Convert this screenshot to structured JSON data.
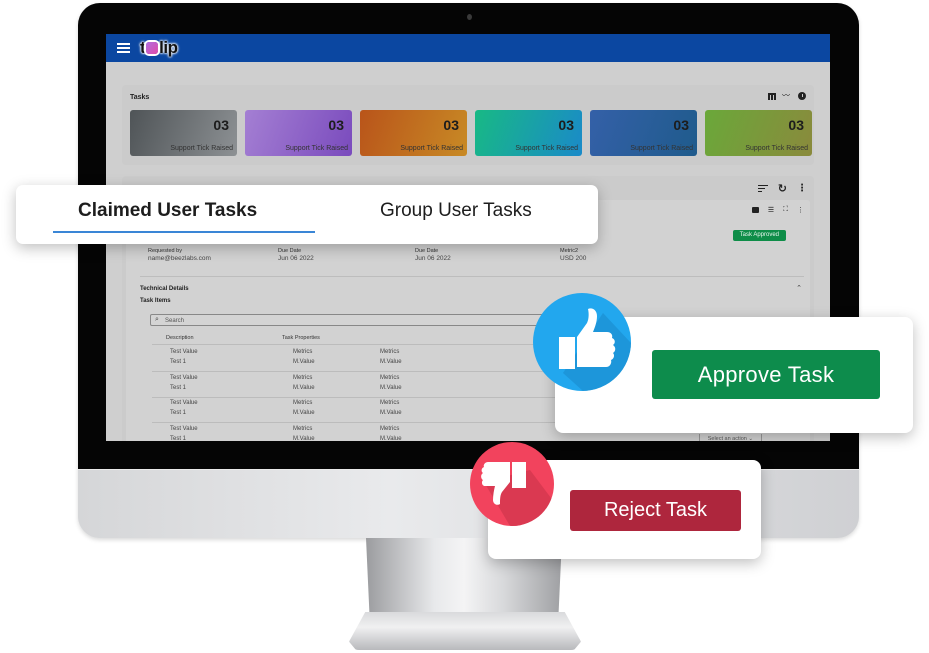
{
  "app": {
    "logo_text_left": "t",
    "logo_text_right": "lip"
  },
  "tasks": {
    "title": "Tasks",
    "view_icons": [
      "table-icon",
      "trend-icon",
      "clock-icon"
    ],
    "cards": [
      {
        "count": "03",
        "label": "Support Tick Raised",
        "color_from": "#4f5457",
        "color_to": "#8d9194"
      },
      {
        "count": "03",
        "label": "Support Tick Raised",
        "color_from": "#a47fd3",
        "color_to": "#7a4bbd"
      },
      {
        "count": "03",
        "label": "Support Tick Raised",
        "color_from": "#b9541a",
        "color_to": "#c88a25"
      },
      {
        "count": "03",
        "label": "Support Tick Raised",
        "color_from": "#18b984",
        "color_to": "#1a8ac9"
      },
      {
        "count": "03",
        "label": "Support Tick Raised",
        "color_from": "#3460a8",
        "color_to": "#1f5b8c"
      },
      {
        "count": "03",
        "label": "Support Tick Raised",
        "color_from": "#6aa83a",
        "color_to": "#8a8a3c"
      }
    ]
  },
  "tabs": {
    "items": [
      {
        "label": "Claimed User Tasks",
        "active": true
      },
      {
        "label": "Group User Tasks",
        "active": false
      }
    ],
    "accent": "#3a86d6"
  },
  "task_detail": {
    "status_badge": "Task Approved",
    "status_color": "#0e8d48",
    "meta": [
      {
        "label": "Requested by",
        "value": "name@beezlabs.com"
      },
      {
        "label": "Due Date",
        "value": "Jun 06 2022"
      },
      {
        "label": "Due Date",
        "value": "Jun 06 2022"
      },
      {
        "label": "Metric2",
        "value": "USD 200"
      }
    ],
    "technical_details_title": "Technical Details",
    "task_items_title": "Task Items",
    "search_placeholder": "Search",
    "columns": [
      "Description",
      "Task Properties"
    ],
    "rows": [
      {
        "desc1": "Test Value",
        "desc2": "Test 1",
        "p1a": "Metrics",
        "p1b": "M.Value",
        "p2a": "Metrics",
        "p2b": "M.Value"
      },
      {
        "desc1": "Test Value",
        "desc2": "Test 1",
        "p1a": "Metrics",
        "p1b": "M.Value",
        "p2a": "Metrics",
        "p2b": "M.Value"
      },
      {
        "desc1": "Test Value",
        "desc2": "Test 1",
        "p1a": "Metrics",
        "p1b": "M.Value",
        "p2a": "Metrics",
        "p2b": "M.Value"
      },
      {
        "desc1": "Test Value",
        "desc2": "Test 1",
        "p1a": "Metrics",
        "p1b": "M.Value",
        "p2a": "Metrics",
        "p2b": "M.Value"
      }
    ],
    "select_action": "Select an action",
    "chevron_down": "⌄"
  },
  "actions": {
    "approve_label": "Approve Task",
    "approve_color": "#0d8c4c",
    "reject_label": "Reject Task",
    "reject_color": "#ae263d"
  }
}
